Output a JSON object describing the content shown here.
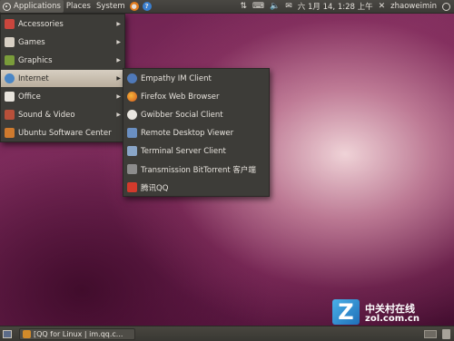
{
  "top_panel": {
    "menus": [
      "Applications",
      "Places",
      "System"
    ],
    "right": {
      "date_time": "六 1月 14, 1:28 上午",
      "username": "zhaoweimin"
    }
  },
  "applications_menu": {
    "items": [
      {
        "label": "Accessories",
        "icon": "accessories-icon",
        "has_submenu": true
      },
      {
        "label": "Games",
        "icon": "games-icon",
        "has_submenu": true
      },
      {
        "label": "Graphics",
        "icon": "graphics-icon",
        "has_submenu": true
      },
      {
        "label": "Internet",
        "icon": "internet-icon",
        "has_submenu": true,
        "highlighted": true
      },
      {
        "label": "Office",
        "icon": "office-icon",
        "has_submenu": true
      },
      {
        "label": "Sound & Video",
        "icon": "sound-video-icon",
        "has_submenu": true
      },
      {
        "label": "Ubuntu Software Center",
        "icon": "software-center-icon",
        "has_submenu": false
      }
    ]
  },
  "internet_submenu": {
    "items": [
      {
        "label": "Empathy IM Client",
        "icon": "empathy-icon"
      },
      {
        "label": "Firefox Web Browser",
        "icon": "firefox-icon"
      },
      {
        "label": "Gwibber Social Client",
        "icon": "gwibber-icon"
      },
      {
        "label": "Remote Desktop Viewer",
        "icon": "remote-desktop-icon"
      },
      {
        "label": "Terminal Server Client",
        "icon": "terminal-server-icon"
      },
      {
        "label": "Transmission BitTorrent 客户端",
        "icon": "transmission-icon"
      },
      {
        "label": "腾讯QQ",
        "icon": "qq-icon"
      }
    ]
  },
  "bottom_panel": {
    "task_button_label": "[QQ for Linux | im.qq.c..."
  },
  "watermark": {
    "letter": "Z",
    "name": "中关村在线",
    "url": "zol.com.cn"
  },
  "colors": {
    "panel": "#3b3a36",
    "menu_bg": "#3d3c38",
    "highlight": "#c9bfb0",
    "wallpaper_accent": "#7e2c5c"
  }
}
